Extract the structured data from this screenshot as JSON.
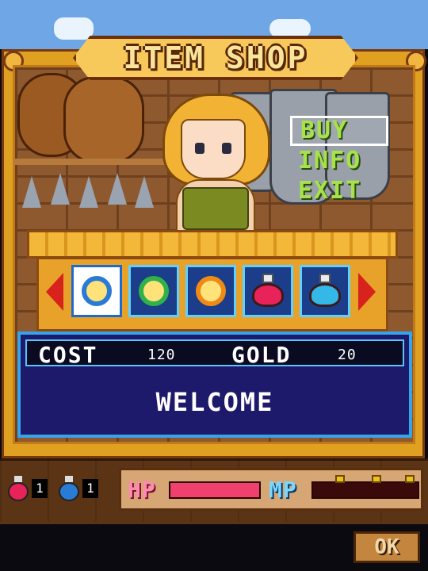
{
  "title": "ITEM SHOP",
  "menu": {
    "items": [
      {
        "label": "BUY",
        "selected": true
      },
      {
        "label": "INFO",
        "selected": false
      },
      {
        "label": "EXIT",
        "selected": false
      }
    ]
  },
  "items": [
    {
      "icon": "blue-orb-icon",
      "color": "#2a7bd6",
      "selected": true
    },
    {
      "icon": "green-orb-icon",
      "color": "#2fb24a",
      "selected": false
    },
    {
      "icon": "orange-orb-icon",
      "color": "#f08a16",
      "selected": false
    },
    {
      "icon": "red-potion-icon",
      "color": "#e8235a",
      "selected": false
    },
    {
      "icon": "blue-potion-icon",
      "color": "#33b8e8",
      "selected": false
    }
  ],
  "info": {
    "cost_label": "COST",
    "cost_value": "120",
    "gold_label": "GOLD",
    "gold_value": "20",
    "message": "WELCOME"
  },
  "inventory": {
    "red_potion_count": "1",
    "blue_potion_count": "1"
  },
  "status": {
    "hp_label": "HP",
    "mp_label": "MP",
    "hp_fill": 1.0,
    "mp_fill": 0.0,
    "hp_color": "#f0406e",
    "mp_color": "#2a7bd6"
  },
  "softkey": {
    "ok_label": "OK"
  }
}
